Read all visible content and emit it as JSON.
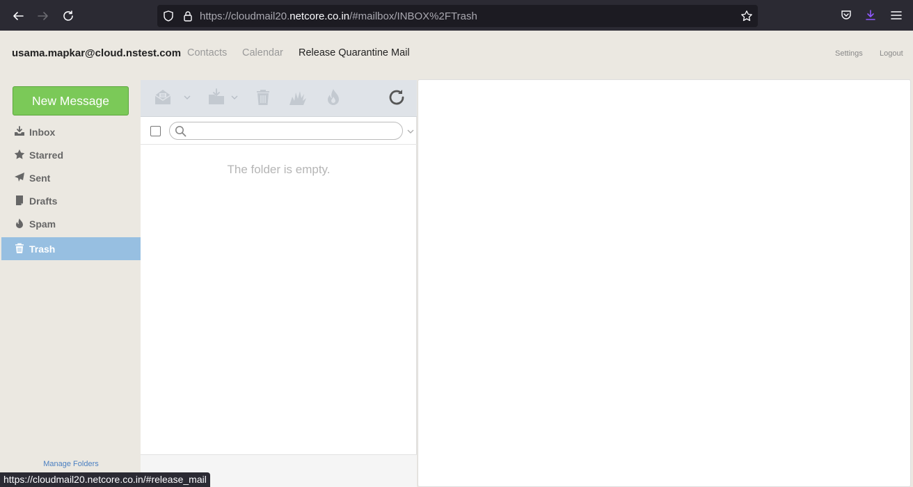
{
  "browser": {
    "url_scheme": "https://cloudmail20.",
    "url_host": "netcore.co.in",
    "url_path": "/#mailbox/INBOX%2FTrash",
    "status_url": "https://cloudmail20.netcore.co.in/#release_mail"
  },
  "header": {
    "user_email": "usama.mapkar@cloud.nstest.com",
    "nav": [
      {
        "label": "Contacts"
      },
      {
        "label": "Calendar"
      },
      {
        "label": "Release Quarantine Mail"
      }
    ],
    "settings_label": "Settings",
    "logout_label": "Logout"
  },
  "sidebar": {
    "new_message_label": "New Message",
    "folders": [
      {
        "label": "Inbox",
        "icon": "inbox-icon"
      },
      {
        "label": "Starred",
        "icon": "star-icon"
      },
      {
        "label": "Sent",
        "icon": "paper-plane-icon"
      },
      {
        "label": "Drafts",
        "icon": "draft-icon"
      },
      {
        "label": "Spam",
        "icon": "flame-icon"
      },
      {
        "label": "Trash",
        "icon": "trash-icon",
        "selected": true
      }
    ],
    "manage_folders_label": "Manage Folders"
  },
  "message_list": {
    "search_placeholder": "",
    "empty_message": "The folder is empty."
  },
  "colors": {
    "accent_green": "#7bc958",
    "selected_folder": "#97bfe1",
    "link_blue": "#4a7fc1"
  }
}
